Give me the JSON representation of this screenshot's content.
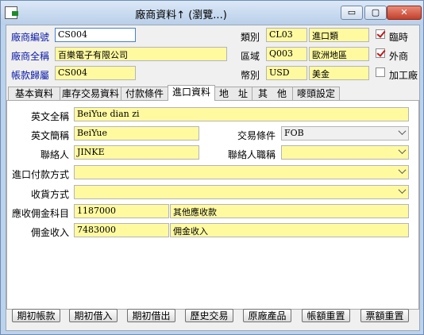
{
  "window": {
    "title": "廠商資料↑ (瀏覽...)",
    "min": "▭",
    "max": "▢",
    "close": "✕"
  },
  "header": {
    "vendor_code_label": "廠商編號",
    "vendor_code": "CS004",
    "vendor_name_label": "廠商全稱",
    "vendor_name": "百樂電子有限公司",
    "account_label": "帳款歸屬",
    "account": "CS004",
    "category_label": "類別",
    "category_code": "CL03",
    "category_name": "進口類",
    "region_label": "區域",
    "region_code": "Q003",
    "region_name": "歐洲地區",
    "currency_label": "幣別",
    "currency_code": "USD",
    "currency_name": "美金",
    "temp_label": "臨時",
    "temp_checked": true,
    "foreign_label": "外商",
    "foreign_checked": true,
    "processing_label": "加工廠",
    "processing_checked": false
  },
  "tabs": [
    "基本資料",
    "庫存交易資料",
    "付款條件",
    "進口資料",
    "地　址",
    "其　他",
    "嘜頭設定"
  ],
  "active_tab": "進口資料",
  "import": {
    "full_name_label": "英文全稱",
    "full_name": "BeiYue dian zi",
    "short_name_label": "英文簡稱",
    "short_name": "BeiYue",
    "trade_terms_label": "交易條件",
    "trade_terms": "FOB",
    "contact_label": "聯絡人",
    "contact": "JINKE",
    "contact_title_label": "聯絡人職稱",
    "contact_title": "",
    "payment_label": "進口付款方式",
    "payment": "",
    "receipt_label": "收貨方式",
    "receipt": "",
    "commission_account_label": "應收佣金科目",
    "commission_account_code": "1187000",
    "commission_account_name": "其他應收款",
    "commission_income_label": "佣金收入",
    "commission_income_code": "7483000",
    "commission_income_name": "佣金收入"
  },
  "buttons": [
    "期初帳款",
    "期初借入",
    "期初借出",
    "歷史交易",
    "原廠產品",
    "帳額重置",
    "票額重置"
  ]
}
